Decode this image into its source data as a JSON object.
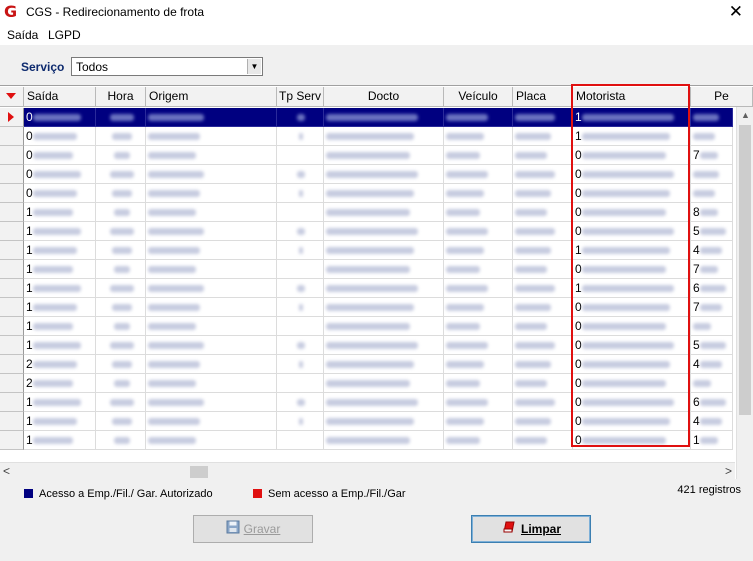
{
  "window": {
    "title": "CGS - Redirecionamento de frota",
    "app_icon": "G",
    "close_label": "✕"
  },
  "menu": [
    "Saída",
    "LGPD"
  ],
  "filter": {
    "label": "Serviço",
    "value": "Todos"
  },
  "grid": {
    "columns": [
      "Saída",
      "Hora",
      "Origem",
      "Tp Serv",
      "Docto",
      "Veículo",
      "Placa",
      "Motorista",
      "Pe"
    ],
    "rows": [
      {
        "saida": "0",
        "motorista": "1",
        "extra": ""
      },
      {
        "saida": "0",
        "motorista": "1",
        "extra": ""
      },
      {
        "saida": "0",
        "motorista": "0",
        "extra": "7"
      },
      {
        "saida": "0",
        "motorista": "0",
        "extra": ""
      },
      {
        "saida": "0",
        "motorista": "0",
        "extra": ""
      },
      {
        "saida": "1",
        "motorista": "0",
        "extra": "8"
      },
      {
        "saida": "1",
        "motorista": "0",
        "extra": "5"
      },
      {
        "saida": "1",
        "motorista": "1",
        "extra": "4"
      },
      {
        "saida": "1",
        "motorista": "0",
        "extra": "7"
      },
      {
        "saida": "1",
        "motorista": "1",
        "extra": "6"
      },
      {
        "saida": "1",
        "motorista": "0",
        "extra": "7"
      },
      {
        "saida": "1",
        "motorista": "0",
        "extra": ""
      },
      {
        "saida": "1",
        "motorista": "0",
        "extra": "5"
      },
      {
        "saida": "2",
        "motorista": "0",
        "extra": "4"
      },
      {
        "saida": "2",
        "motorista": "0",
        "extra": ""
      },
      {
        "saida": "1",
        "motorista": "0",
        "extra": "6"
      },
      {
        "saida": "1",
        "motorista": "0",
        "extra": "4"
      },
      {
        "saida": "1",
        "motorista": "0",
        "extra": "1"
      }
    ]
  },
  "legend": [
    {
      "label": "Acesso a Emp./Fil./ Gar. Autorizado",
      "color": "#000080"
    },
    {
      "label": "Sem acesso a Emp./Fil./Gar",
      "color": "#e01010"
    }
  ],
  "record_count": "421 registros",
  "buttons": {
    "save": "Gravar",
    "clear": "Limpar"
  },
  "icons": {
    "app": "cgs-logo-icon",
    "close": "close-icon",
    "dropdown": "chevron-down-icon",
    "save": "floppy-disk-icon",
    "clear": "eraser-icon"
  }
}
